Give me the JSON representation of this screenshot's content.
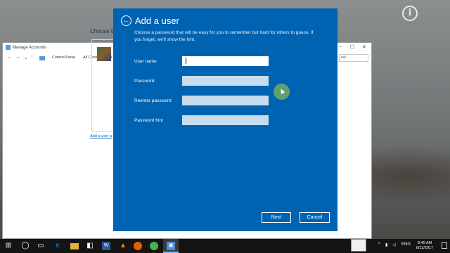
{
  "desktop": {
    "info_icon_glyph": "i"
  },
  "control_panel": {
    "window_title": "Manage Accounts",
    "breadcrumb_1": "Control Panel",
    "breadcrumb_2": "All Control Panel I",
    "search_placeholder": "nel",
    "heading": "Choose th",
    "add_user_link": "Add a user a",
    "window_buttons": [
      "–",
      "☐",
      "✕"
    ]
  },
  "dialog": {
    "title": "Add a user",
    "description": "Choose a password that will be easy for you to remember but hard for others to guess. If you forget, we'll show the hint.",
    "fields": [
      {
        "label": "User name",
        "value": "",
        "state": "active"
      },
      {
        "label": "Password",
        "value": "",
        "state": "inactive"
      },
      {
        "label": "Reenter password",
        "value": "",
        "state": "inactive"
      },
      {
        "label": "Password hint",
        "value": "",
        "state": "inactive"
      }
    ],
    "next_label": "Next",
    "cancel_label": "Cancel"
  },
  "taskbar": {
    "start_glyph": "⊞",
    "search_glyph": "◯",
    "language": "ENG",
    "time": "8:40 AM",
    "date": "8/11/2017"
  },
  "colors": {
    "dialog_bg": "#0063b1",
    "taskbar_bg": "#141414",
    "inactive_field": "#c7dcef"
  }
}
